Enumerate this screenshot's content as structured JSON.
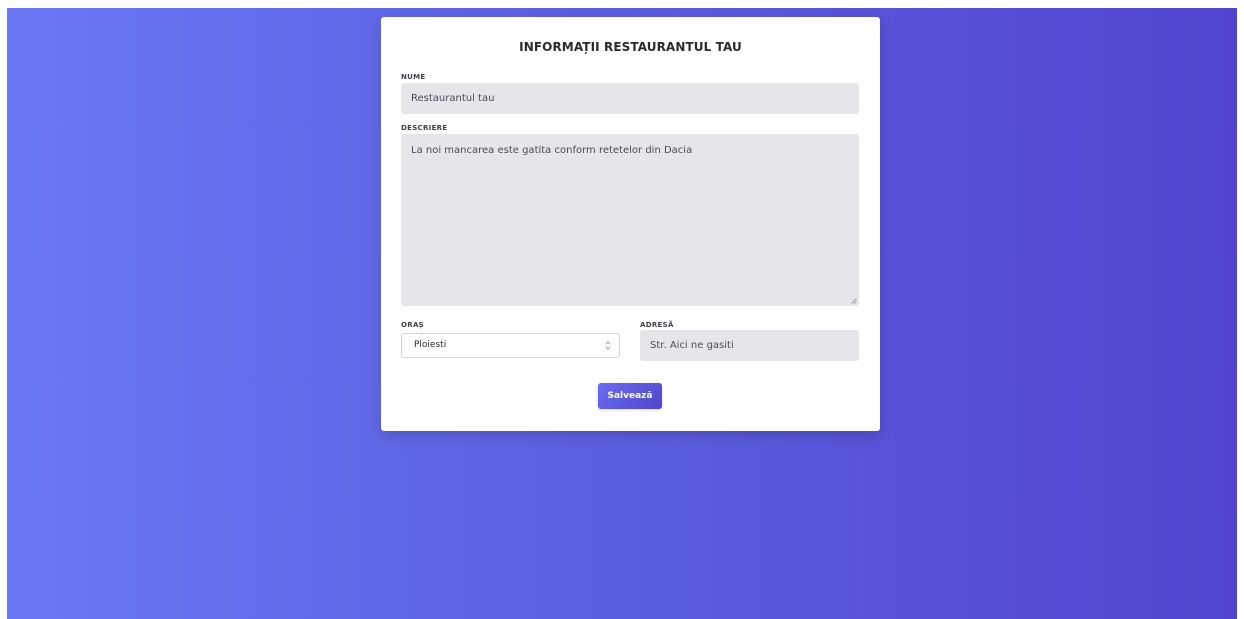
{
  "form": {
    "title": "INFORMAȚII RESTAURANTUL TAU",
    "nume": {
      "label": "NUME",
      "value": "Restaurantul tau"
    },
    "descriere": {
      "label": "DESCRIERE",
      "value": "La noi mancarea este gatita conform retetelor din Dacia"
    },
    "oras": {
      "label": "ORAȘ",
      "selected": "Ploiesti"
    },
    "adresa": {
      "label": "ADRESĂ",
      "value": "Str. Aici ne gasiti"
    },
    "save_label": "Salvează"
  },
  "colors": {
    "background_start": "#6b78f3",
    "background_end": "#5246cf",
    "input_fill": "#e5e6ea",
    "button_start": "#6a6cf0",
    "button_end": "#4f46c8"
  }
}
